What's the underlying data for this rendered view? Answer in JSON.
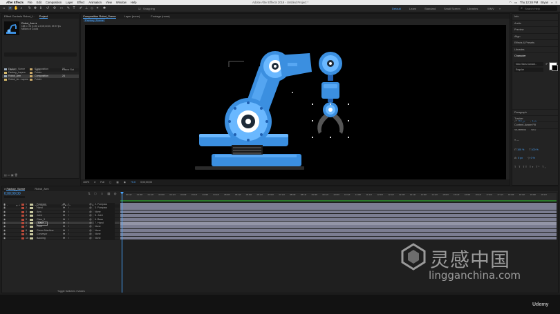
{
  "menubar": {
    "app_name": "After Effects",
    "items": [
      "File",
      "Edit",
      "Composition",
      "Layer",
      "Effect",
      "Animation",
      "View",
      "Window",
      "Help"
    ],
    "window_title": "Adobe After Effects 2019 - Untitled Project *",
    "clock": "Thu 12:28 PM",
    "user": "Bryan"
  },
  "toolbar": {
    "snapping_label": "Snapping",
    "workspaces": [
      "Default",
      "Learn",
      "Standard",
      "Small Screen",
      "Libraries",
      "WMV"
    ],
    "active_workspace": "Default",
    "search_placeholder": "Search Help"
  },
  "project_panel": {
    "tabs": [
      "Effect Controls Robot_I...",
      "Project"
    ],
    "selected_item": {
      "name": "Robot_Arm ▾",
      "info1": "158 x 178 (1.00) Δ 0;00;10;00, 29.97 fps",
      "info2": "Millions of Colors"
    },
    "columns": [
      "Name",
      "Type",
      "Frame Rat",
      "In Point"
    ],
    "items": [
      {
        "name": "Factory_Scene",
        "type": "Composition",
        "fps": "24",
        "color": "#c9a86a"
      },
      {
        "name": "Factory_Layers",
        "type": "Folder",
        "fps": "",
        "color": "#c9a86a"
      },
      {
        "name": "Robot_Arm",
        "type": "Composition",
        "fps": "24",
        "color": "#c9a86a"
      },
      {
        "name": "Robot_Ar...Layers",
        "type": "Folder",
        "fps": "",
        "color": "#c9a86a"
      }
    ]
  },
  "comp_panel": {
    "tabs": [
      "Composition Robot_Scene",
      "Layer (none)",
      "Footage (none)"
    ],
    "breadcrumb": "Factory_Scene",
    "zoom": "100%",
    "resolution": "Full",
    "timecode": "0;00;00;00",
    "exposure": "+0.0"
  },
  "right_panel": {
    "items": [
      "Info",
      "Audio",
      "Preview",
      "Align",
      "Effects & Presets",
      "Libraries"
    ],
    "character": {
      "title": "Character",
      "font": "Noto Sans Canadi...",
      "style": "Regular",
      "size": "154 px",
      "leading": "Auto",
      "kerning": "Metrics",
      "tracking": "0",
      "vscale": "100 %",
      "hscale": "100 %",
      "baseline": "0 px",
      "tsume": "0 %"
    },
    "items_below": [
      "Paragraph",
      "Tracker",
      "Content-Aware Fill"
    ]
  },
  "timeline": {
    "tabs": [
      "Factory_Scene",
      "Robot_Arm"
    ],
    "timecode": "0;00;00;00",
    "columns": [
      "Layer Name",
      "Parent & Link"
    ],
    "layers": [
      {
        "num": "1",
        "name": "Forepaw",
        "parent": "2. Forepaw",
        "color": "#b84a3a"
      },
      {
        "num": "2",
        "name": "Hand",
        "parent": "3. Forepaw",
        "color": "#b84a3a"
      },
      {
        "num": "3",
        "name": "Arm",
        "parent": "None",
        "color": "#b84a3a"
      },
      {
        "num": "4",
        "name": "Joint",
        "parent": "5. Joint",
        "color": "#b84a3a"
      },
      {
        "num": "5",
        "name": "Claw_3",
        "parent": "6. Base",
        "color": "#b84a3a"
      },
      {
        "num": "6",
        "name": "Base_1",
        "parent": "7. Hand",
        "color": "#b84a3a"
      },
      {
        "num": "7",
        "name": "Floor",
        "parent": "None",
        "color": "#b84a3a"
      },
      {
        "num": "8",
        "name": "Green Machine",
        "parent": "None",
        "color": "#b84a3a"
      },
      {
        "num": "9",
        "name": "Conveyor",
        "parent": "None",
        "color": "#b84a3a"
      },
      {
        "num": "10",
        "name": "Backing",
        "parent": "None",
        "color": "#b84a3a"
      }
    ],
    "ruler": [
      "00:12f",
      "01:00f",
      "01:12f",
      "02:00f",
      "02:12f",
      "03:00f",
      "03:12f",
      "04:00f",
      "04:12f",
      "05:00f",
      "05:12f",
      "06:00f",
      "06:12f",
      "07:00f",
      "07:12f",
      "08:00f",
      "08:12f",
      "09:00f",
      "09:12f",
      "10:00f",
      "10:12f",
      "11:00f",
      "11:12f",
      "12:00f",
      "12:12f",
      "13:00f",
      "13:12f",
      "14:00f",
      "14:12f",
      "15:00f",
      "15:12f",
      "16:00f",
      "16:12f",
      "17:00f",
      "17:12f",
      "18:00f",
      "18:12f",
      "19:00f",
      "19:12f"
    ],
    "toggle_label": "Toggle Switches / Modes"
  },
  "watermark": {
    "cn": "灵感中国",
    "url": "lingganchina.com"
  },
  "udemy": "Udemy",
  "colors": {
    "accent": "#4aa6ff",
    "robot_blue": "#3b8fe0",
    "robot_light": "#6ab8ff",
    "robot_dark": "#1f5fb0",
    "layer_bar": "#8c8ea6"
  }
}
